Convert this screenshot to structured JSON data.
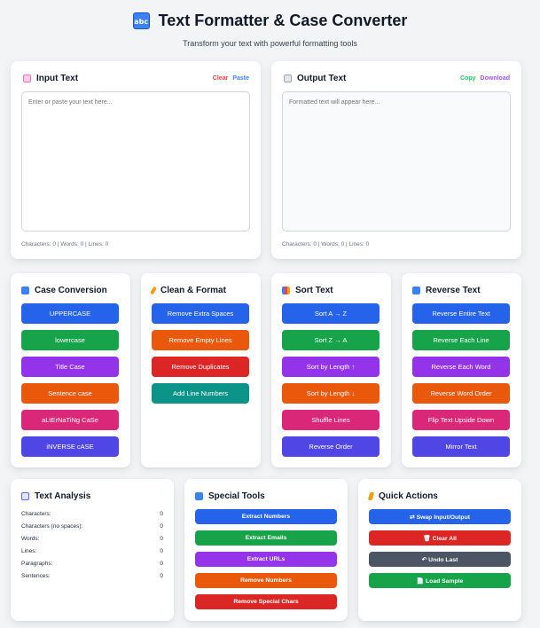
{
  "header": {
    "logo_glyph": "abc",
    "title": "Text Formatter & Case Converter",
    "subtitle": "Transform your text with powerful formatting tools"
  },
  "input": {
    "title": "Input Text",
    "clear_label": "Clear",
    "paste_label": "Paste",
    "placeholder": "Enter or paste your text here...",
    "stats": "Characters: 0 | Words: 0 | Lines: 0"
  },
  "output": {
    "title": "Output Text",
    "copy_label": "Copy",
    "download_label": "Download",
    "placeholder": "Formatted text will appear here...",
    "stats": "Characters: 0 | Words: 0 | Lines: 0"
  },
  "case_conversion": {
    "title": "Case Conversion",
    "buttons": [
      {
        "label": "UPPERCASE",
        "color": "#2563eb"
      },
      {
        "label": "lowercase",
        "color": "#16a34a"
      },
      {
        "label": "Title Case",
        "color": "#9333ea"
      },
      {
        "label": "Sentence case",
        "color": "#ea580c"
      },
      {
        "label": "aLtErNaTiNg CaSe",
        "color": "#db2777"
      },
      {
        "label": "iNVERSE cASE",
        "color": "#4f46e5"
      }
    ]
  },
  "clean_format": {
    "title": "Clean & Format",
    "buttons": [
      {
        "label": "Remove Extra Spaces",
        "color": "#2563eb"
      },
      {
        "label": "Remove Empty Lines",
        "color": "#ea580c"
      },
      {
        "label": "Remove Duplicates",
        "color": "#dc2626"
      },
      {
        "label": "Add Line Numbers",
        "color": "#0d9488"
      }
    ]
  },
  "sort_text": {
    "title": "Sort Text",
    "buttons": [
      {
        "label": "Sort A → Z",
        "color": "#2563eb"
      },
      {
        "label": "Sort Z → A",
        "color": "#16a34a"
      },
      {
        "label": "Sort by Length ↑",
        "color": "#9333ea"
      },
      {
        "label": "Sort by Length ↓",
        "color": "#ea580c"
      },
      {
        "label": "Shuffle Lines",
        "color": "#db2777"
      },
      {
        "label": "Reverse Order",
        "color": "#4f46e5"
      }
    ]
  },
  "reverse_text": {
    "title": "Reverse Text",
    "buttons": [
      {
        "label": "Reverse Entire Text",
        "color": "#2563eb"
      },
      {
        "label": "Reverse Each Line",
        "color": "#16a34a"
      },
      {
        "label": "Reverse Each Word",
        "color": "#9333ea"
      },
      {
        "label": "Reverse Word Order",
        "color": "#ea580c"
      },
      {
        "label": "Flip Text Upside Down",
        "color": "#db2777"
      },
      {
        "label": "Mirror Text",
        "color": "#4f46e5"
      }
    ]
  },
  "text_analysis": {
    "title": "Text Analysis",
    "rows": [
      {
        "label": "Characters:",
        "value": "0"
      },
      {
        "label": "Characters (no spaces):",
        "value": "0"
      },
      {
        "label": "Words:",
        "value": "0"
      },
      {
        "label": "Lines:",
        "value": "0"
      },
      {
        "label": "Paragraphs:",
        "value": "0"
      },
      {
        "label": "Sentences:",
        "value": "0"
      }
    ]
  },
  "special_tools": {
    "title": "Special Tools",
    "buttons": [
      {
        "label": "Extract Numbers",
        "color": "#2563eb"
      },
      {
        "label": "Extract Emails",
        "color": "#16a34a"
      },
      {
        "label": "Extract URLs",
        "color": "#9333ea"
      },
      {
        "label": "Remove Numbers",
        "color": "#ea580c"
      },
      {
        "label": "Remove Special Chars",
        "color": "#dc2626"
      }
    ]
  },
  "quick_actions": {
    "title": "Quick Actions",
    "buttons": [
      {
        "label": "⇄ Swap Input/Output",
        "color": "#2563eb"
      },
      {
        "label": "🗑 Clear All",
        "color": "#dc2626"
      },
      {
        "label": "↶ Undo Last",
        "color": "#4b5563"
      },
      {
        "label": "📄 Load Sample",
        "color": "#16a34a"
      }
    ]
  },
  "colors": {
    "clear_link": "#ef4444",
    "paste_link": "#3b82f6",
    "copy_link": "#22c55e",
    "download_link": "#a855f7"
  }
}
